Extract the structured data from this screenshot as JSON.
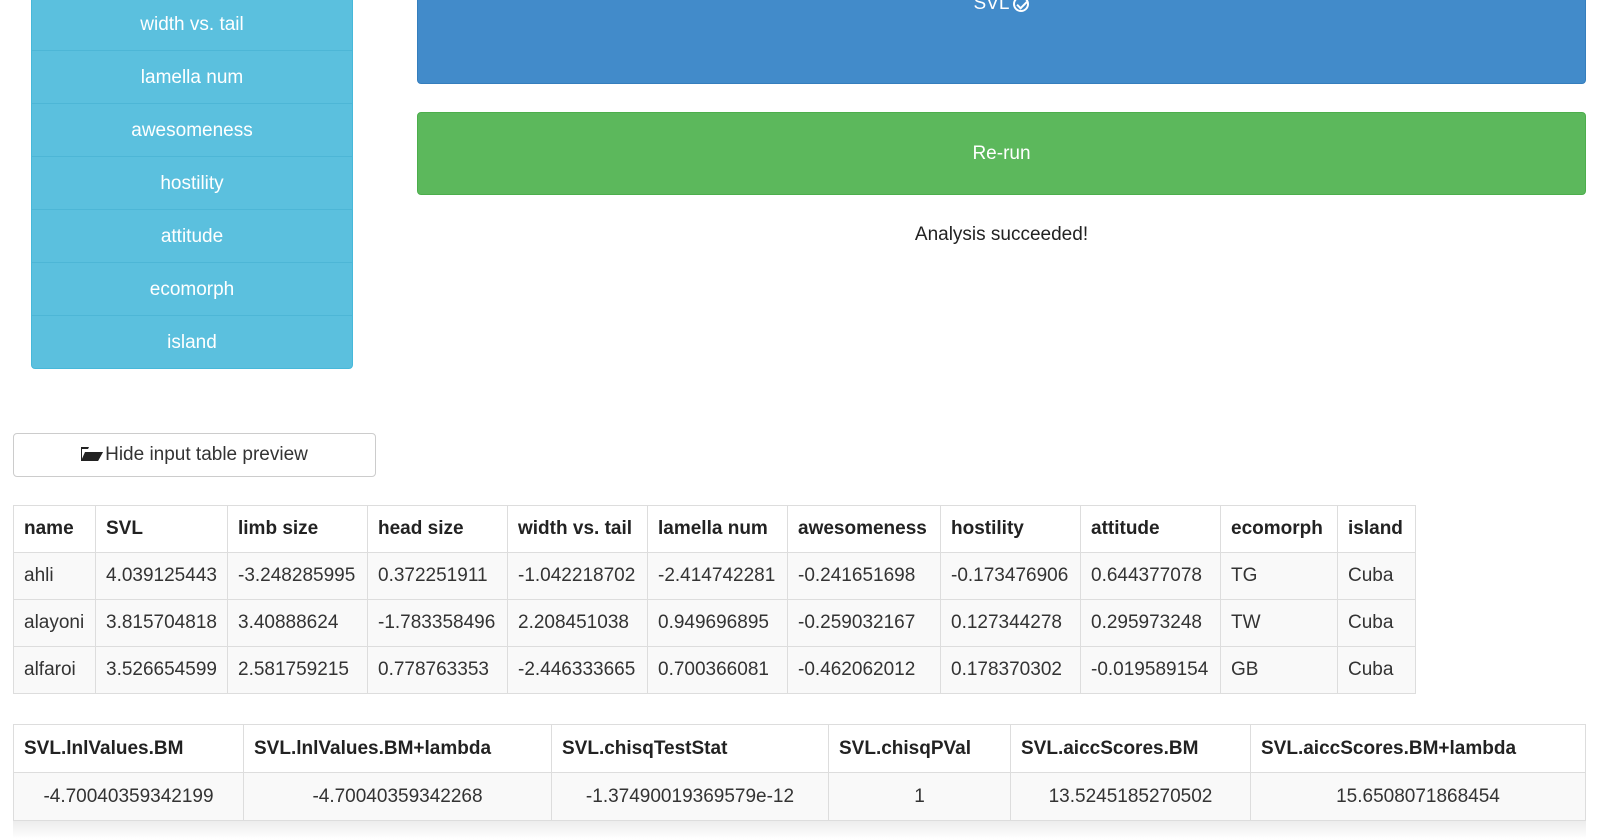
{
  "sidebar": {
    "items": [
      "width vs. tail",
      "lamella num",
      "awesomeness",
      "hostility",
      "attitude",
      "ecomorph",
      "island"
    ]
  },
  "svl_button_label": "SVL",
  "rerun_button_label": "Re-run",
  "status_text": "Analysis succeeded!",
  "preview_button_label": "Hide input table preview",
  "icons": {
    "svl": "check-circle-icon",
    "preview": "folder-open-icon"
  },
  "colors": {
    "info": "#5bc0de",
    "primary": "#428bca",
    "success": "#5cb85c"
  },
  "input_table": {
    "headers": [
      "name",
      "SVL",
      "limb size",
      "head size",
      "width vs. tail",
      "lamella num",
      "awesomeness",
      "hostility",
      "attitude",
      "ecomorph",
      "island"
    ],
    "rows": [
      [
        "ahli",
        "4.039125443",
        "-3.248285995",
        "0.372251911",
        "-1.042218702",
        "-2.414742281",
        "-0.241651698",
        "-0.173476906",
        "0.644377078",
        "TG",
        "Cuba"
      ],
      [
        "alayoni",
        "3.815704818",
        "3.40888624",
        "-1.783358496",
        "2.208451038",
        "0.949696895",
        "-0.259032167",
        "0.127344278",
        "0.295973248",
        "TW",
        "Cuba"
      ],
      [
        "alfaroi",
        "3.526654599",
        "2.581759215",
        "0.778763353",
        "-2.446333665",
        "0.700366081",
        "-0.462062012",
        "0.178370302",
        "-0.019589154",
        "GB",
        "Cuba"
      ]
    ]
  },
  "results_table": {
    "headers": [
      "SVL.lnlValues.BM",
      "SVL.lnlValues.BM+lambda",
      "SVL.chisqTestStat",
      "SVL.chisqPVal",
      "SVL.aiccScores.BM",
      "SVL.aiccScores.BM+lambda"
    ],
    "rows": [
      [
        "-4.70040359342199",
        "-4.70040359342268",
        "-1.37490019369579e-12",
        "1",
        "13.5245185270502",
        "15.6508071868454"
      ]
    ]
  }
}
